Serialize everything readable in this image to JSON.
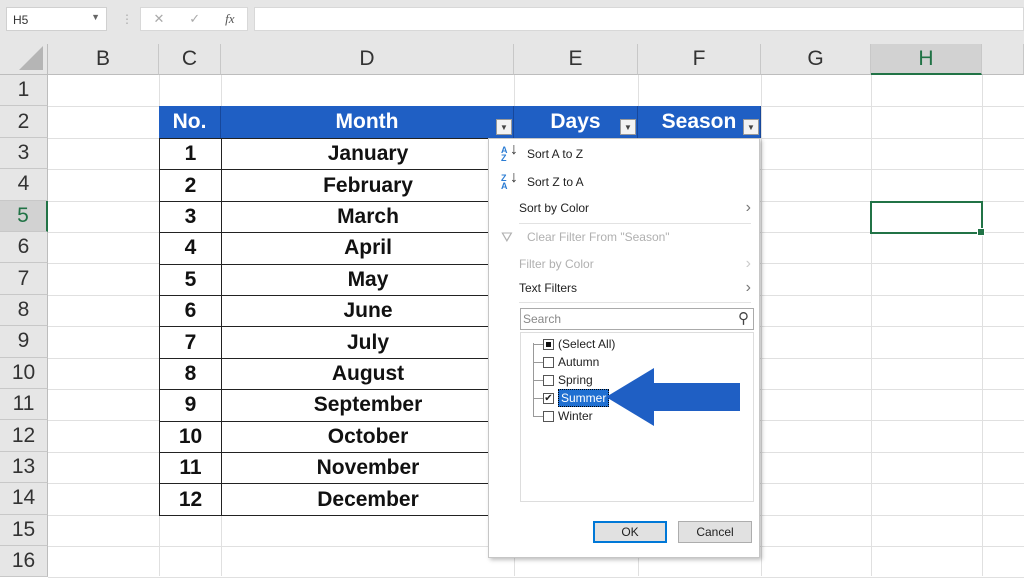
{
  "formula_bar": {
    "name_box": "H5",
    "cancel": "✕",
    "enter": "✓",
    "fx": "fx",
    "value": ""
  },
  "columns": [
    "B",
    "C",
    "D",
    "E",
    "F",
    "G",
    "H"
  ],
  "selected_column": "H",
  "rows": [
    "1",
    "2",
    "3",
    "4",
    "5",
    "6",
    "7",
    "8",
    "9",
    "10",
    "11",
    "12",
    "13",
    "14",
    "15",
    "16"
  ],
  "selected_row": "5",
  "table": {
    "headers": [
      "No.",
      "Month",
      "Days",
      "Season"
    ],
    "rows": [
      [
        "1",
        "January"
      ],
      [
        "2",
        "February"
      ],
      [
        "3",
        "March"
      ],
      [
        "4",
        "April"
      ],
      [
        "5",
        "May"
      ],
      [
        "6",
        "June"
      ],
      [
        "7",
        "July"
      ],
      [
        "8",
        "August"
      ],
      [
        "9",
        "September"
      ],
      [
        "10",
        "October"
      ],
      [
        "11",
        "November"
      ],
      [
        "12",
        "December"
      ]
    ],
    "header_color": "#1f5fc4"
  },
  "filter_menu": {
    "sort_az": "Sort A to Z",
    "sort_za": "Sort Z to A",
    "sort_by_color": "Sort by Color",
    "clear_filter": "Clear Filter From \"Season\"",
    "filter_by_color": "Filter by Color",
    "text_filters": "Text Filters",
    "search_placeholder": "Search",
    "items": [
      {
        "label": "(Select All)",
        "state": "partial"
      },
      {
        "label": "Autumn",
        "state": "unchecked"
      },
      {
        "label": "Spring",
        "state": "unchecked"
      },
      {
        "label": "Summer",
        "state": "checked"
      },
      {
        "label": "Winter",
        "state": "unchecked"
      }
    ],
    "ok": "OK",
    "cancel": "Cancel"
  },
  "annotation": {
    "arrow_color": "#1f5fc4",
    "points_to": "Summer"
  }
}
